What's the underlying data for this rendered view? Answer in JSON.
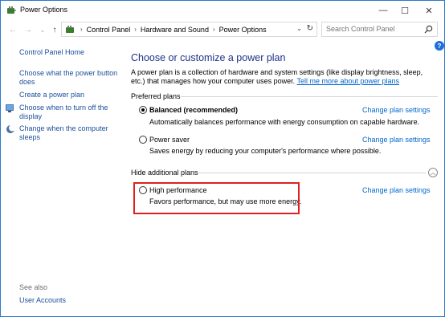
{
  "window": {
    "title": "Power Options"
  },
  "controls": {
    "minimize": "—",
    "maximize": "☐",
    "close": "✕"
  },
  "nav": {
    "back": "←",
    "forward": "→",
    "recent": "⌄",
    "up": "↑",
    "breadcrumb_sep": "›",
    "crumbs": [
      "Control Panel",
      "Hardware and Sound",
      "Power Options"
    ],
    "dropdown": "⌄",
    "refresh": "↻",
    "search_placeholder": "Search Control Panel"
  },
  "help_label": "?",
  "sidebar": {
    "home": "Control Panel Home",
    "links": [
      "Choose what the power button does",
      "Create a power plan",
      "Choose when to turn off the display",
      "Change when the computer sleeps"
    ],
    "see_also_label": "See also",
    "see_also_links": [
      "User Accounts"
    ]
  },
  "main": {
    "heading": "Choose or customize a power plan",
    "intro": "A power plan is a collection of hardware and system settings (like display brightness, sleep, etc.) that manages how your computer uses power.",
    "intro_link": "Tell me more about power plans",
    "preferred_title": "Preferred plans",
    "additional_title": "Hide additional plans",
    "collapse_glyph": "︿",
    "plans": [
      {
        "name": "Balanced (recommended)",
        "desc": "Automatically balances performance with energy consumption on capable hardware.",
        "link": "Change plan settings",
        "selected": true
      },
      {
        "name": "Power saver",
        "desc": "Saves energy by reducing your computer's performance where possible.",
        "link": "Change plan settings",
        "selected": false
      },
      {
        "name": "High performance",
        "desc": "Favors performance, but may use more energy.",
        "link": "Change plan settings",
        "selected": false
      }
    ]
  }
}
